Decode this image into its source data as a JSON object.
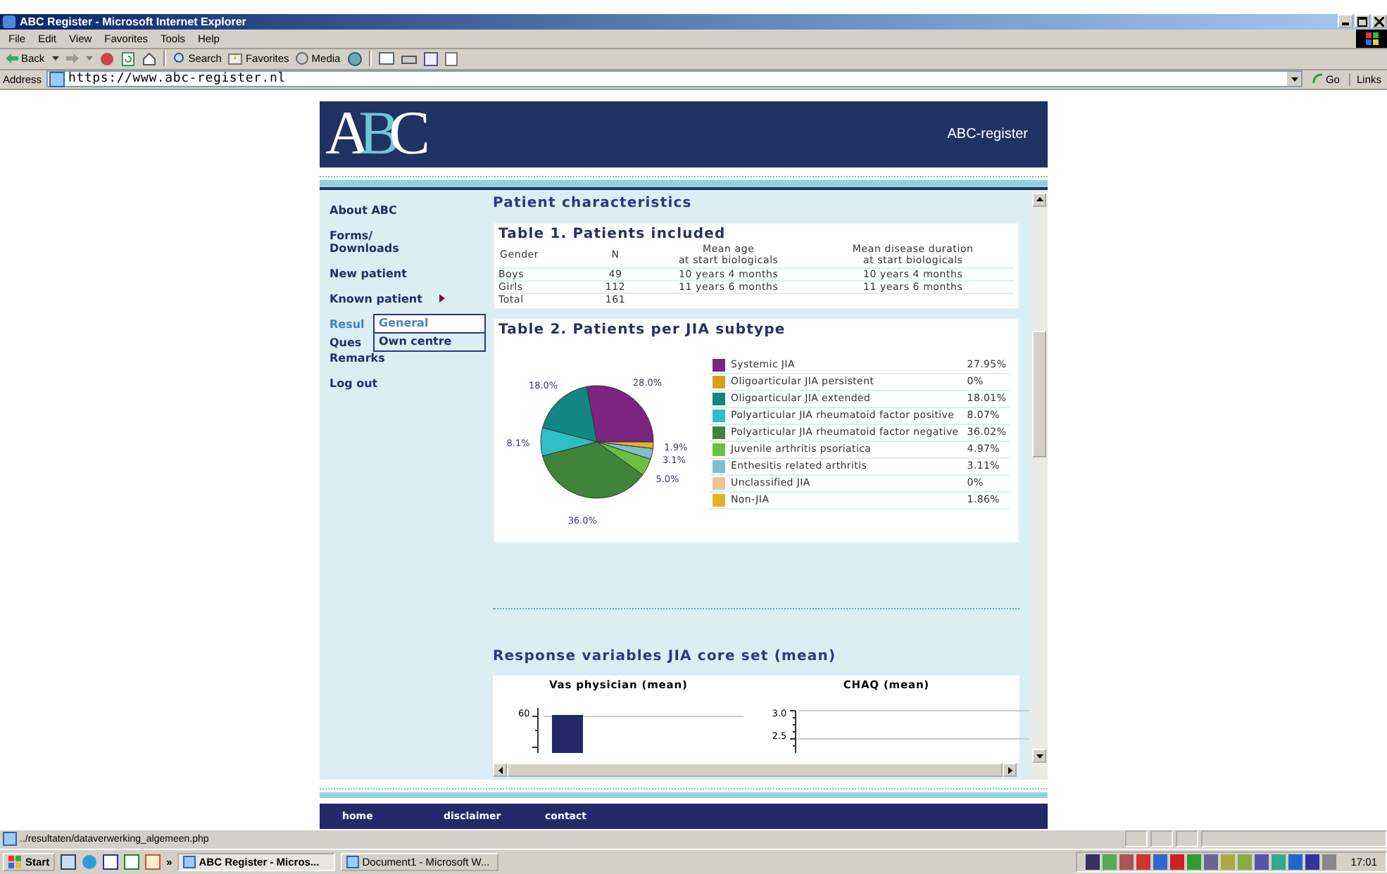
{
  "window": {
    "title": "ABC Register - Microsoft Internet Explorer"
  },
  "menu": [
    "File",
    "Edit",
    "View",
    "Favorites",
    "Tools",
    "Help"
  ],
  "toolbar": {
    "back": "Back",
    "search": "Search",
    "favorites": "Favorites",
    "media": "Media"
  },
  "address": {
    "label": "Address",
    "url": "https://www.abc-register.nl",
    "go": "Go",
    "links": "Links"
  },
  "site": {
    "logo": "ABC",
    "name": "ABC-register",
    "nav": [
      {
        "label": "About ABC",
        "selected": false,
        "has_submenu": false
      },
      {
        "label": "Forms/\nDownloads",
        "selected": false,
        "has_submenu": false
      },
      {
        "label": "New patient",
        "selected": false,
        "has_submenu": false
      },
      {
        "label": "Known patient",
        "selected": false,
        "has_submenu": true
      },
      {
        "label": "Resul",
        "selected": true,
        "has_submenu": false
      },
      {
        "label": "Ques",
        "selected": false,
        "has_submenu": false
      },
      {
        "label": "Remarks",
        "selected": false,
        "has_submenu": false
      },
      {
        "label": "Log out",
        "selected": false,
        "has_submenu": false
      }
    ],
    "submenu": [
      {
        "label": "General",
        "selected": true
      },
      {
        "label": "Own centre",
        "selected": false
      }
    ],
    "section_title": "Patient characteristics",
    "table1": {
      "title": "Table 1. Patients included",
      "columns": [
        "Gender",
        "N",
        "Mean age\nat start biologicals",
        "Mean disease duration\nat start biologicals"
      ],
      "rows": [
        [
          "Boys",
          "49",
          "10 years 4 months",
          "10 years 4 months"
        ],
        [
          "Girls",
          "112",
          "11 years 6 months",
          "11 years 6 months"
        ],
        [
          "Total",
          "161"
        ]
      ]
    },
    "table2": {
      "title": "Table 2. Patients per JIA subtype",
      "chart_data": {
        "type": "pie",
        "categories": [
          "Systemic JIA",
          "Oligoarticular JIA persistent",
          "Oligoarticular JIA extended",
          "Polyarticular JIA rheumatoid factor positive",
          "Polyarticular JIA rheumatoid factor negative",
          "Juvenile arthritis psoriatica",
          "Enthesitis related arthritis",
          "Unclassified JIA",
          "Non-JIA"
        ],
        "values": [
          27.95,
          0,
          18.01,
          8.07,
          36.02,
          4.97,
          3.11,
          0,
          1.86
        ],
        "value_labels": [
          "28.0%",
          null,
          "18.0%",
          "8.1%",
          "36.0%",
          "5.0%",
          "3.1%",
          null,
          "1.9%"
        ]
      },
      "legend": [
        {
          "color": "#7b2580",
          "share": "27.95%"
        },
        {
          "color": "#d4a020",
          "share": "0%"
        },
        {
          "color": "#138585",
          "share": "18.01%"
        },
        {
          "color": "#2ebfc4",
          "share": "8.07%"
        },
        {
          "color": "#3f8438",
          "share": "36.02%"
        },
        {
          "color": "#6cbf3f",
          "share": "4.97%"
        },
        {
          "color": "#7ec0c8",
          "share": "3.11%"
        },
        {
          "color": "#ecc596",
          "share": "0%"
        },
        {
          "color": "#e8b02a",
          "share": "1.86%"
        }
      ]
    },
    "response_title": "Response variables JIA core set (mean)",
    "charts": [
      {
        "title": "Vas physician (mean)",
        "ticks": [
          "60"
        ]
      },
      {
        "title": "CHAQ (mean)",
        "ticks": [
          "3.0",
          "2.5"
        ]
      }
    ],
    "footer": [
      "home",
      "disclaimer",
      "contact"
    ]
  },
  "status": "../resultaten/dataverwerking_algemeen.php",
  "taskbar": {
    "start": "Start",
    "more": "»",
    "tasks": [
      {
        "label": "ABC Register - Micros...",
        "selected": true
      },
      {
        "label": "Document1 - Microsoft W...",
        "selected": false
      }
    ],
    "clock": "17:01"
  }
}
